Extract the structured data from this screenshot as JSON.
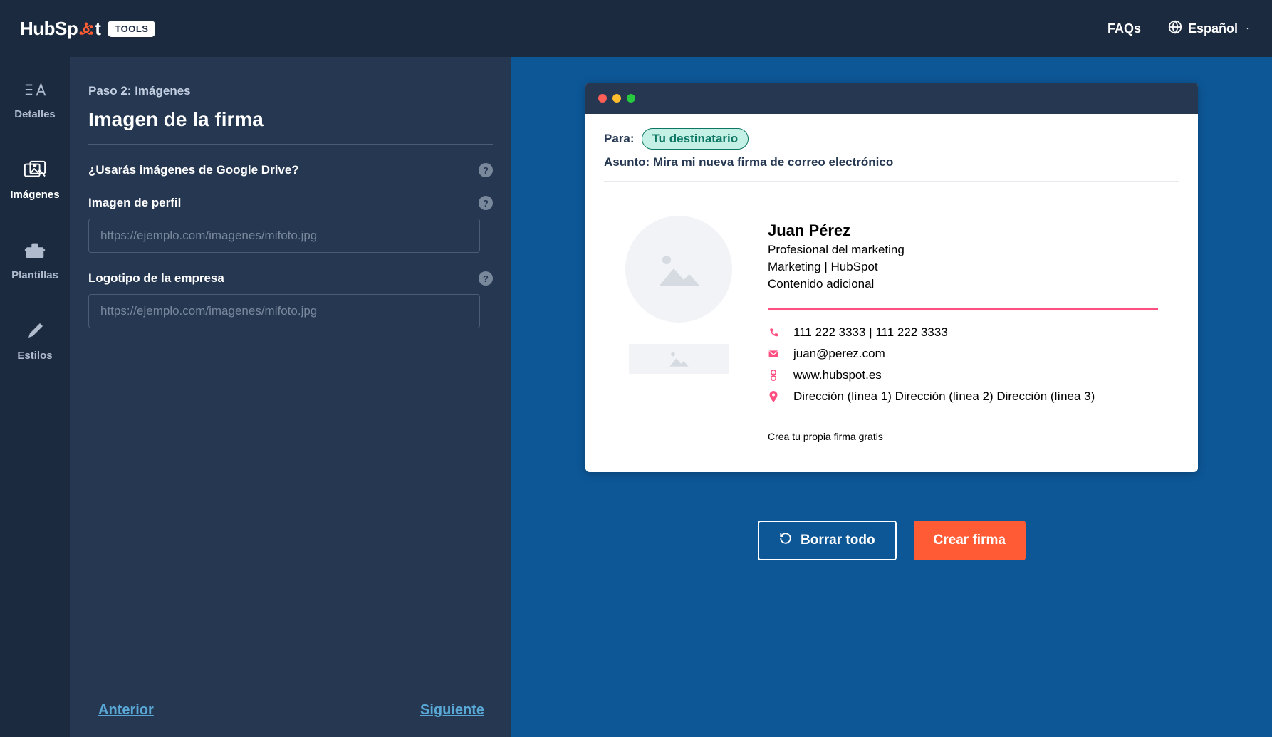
{
  "topbar": {
    "brand_a": "HubSp",
    "brand_b": "t",
    "tools_badge": "TOOLS",
    "faqs": "FAQs",
    "language": "Español"
  },
  "sidebar": {
    "details": "Detalles",
    "images": "Imágenes",
    "templates": "Plantillas",
    "styles": "Estilos"
  },
  "form": {
    "step_label": "Paso 2: Imágenes",
    "title": "Imagen de la firma",
    "gdrive_question": "¿Usarás imágenes de Google Drive?",
    "profile_label": "Imagen de perfil",
    "profile_placeholder": "https://ejemplo.com/imagenes/mifoto.jpg",
    "logo_label": "Logotipo de la empresa",
    "logo_placeholder": "https://ejemplo.com/imagenes/mifoto.jpg",
    "prev": "Anterior",
    "next": "Siguiente"
  },
  "email": {
    "to_label": "Para:",
    "recipient": "Tu destinatario",
    "subject": "Asunto: Mira mi nueva firma de correo electrónico"
  },
  "signature": {
    "name": "Juan Pérez",
    "role": "Profesional del marketing",
    "dept_company": "Marketing | HubSpot",
    "extra": "Contenido adicional",
    "phone": "111 222 3333 | 111 222 3333",
    "email": "juan@perez.com",
    "website": "www.hubspot.es",
    "address": "Dirección (línea 1) Dirección (línea 2) Dirección (línea 3)",
    "cta_link": "Crea tu propia firma gratis"
  },
  "actions": {
    "clear": "Borrar todo",
    "create": "Crear firma"
  },
  "colors": {
    "accent": "#ff5c35",
    "pink": "#ff4f81",
    "blue_bg": "#0d5797"
  }
}
